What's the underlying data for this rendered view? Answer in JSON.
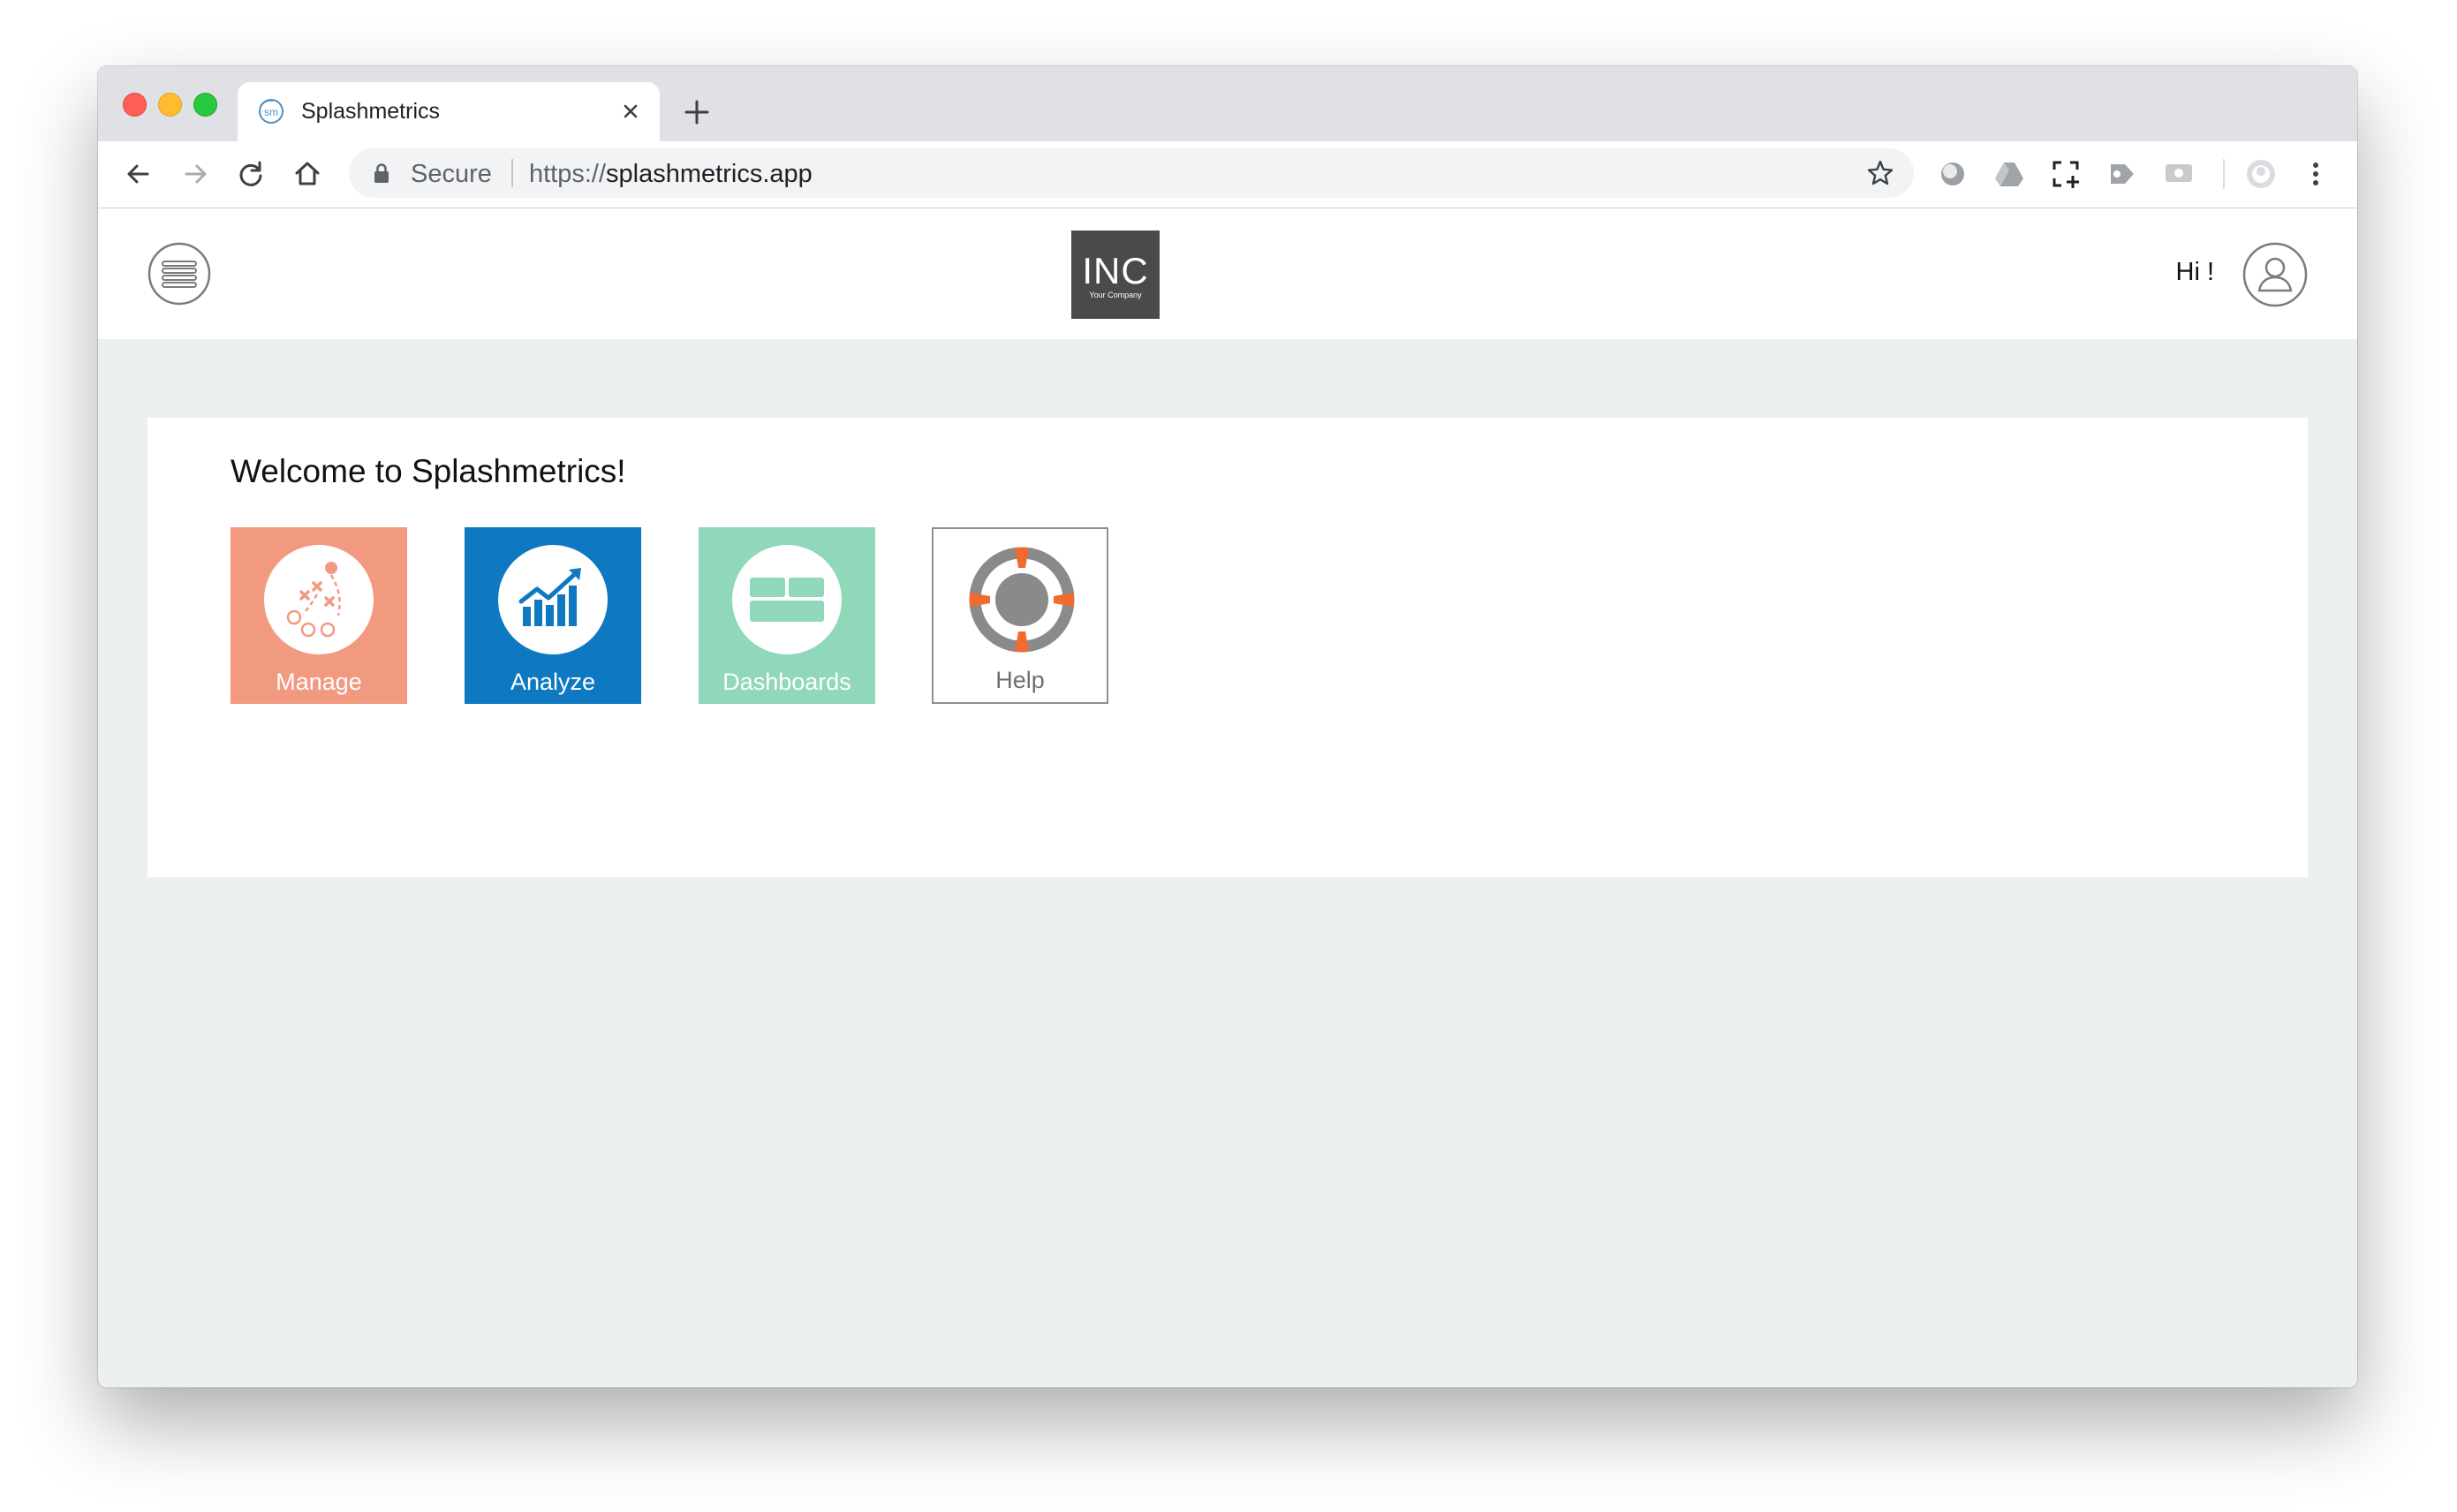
{
  "browser": {
    "tab": {
      "title": "Splashmetrics",
      "favicon_text": "sm"
    },
    "address_bar": {
      "security_label": "Secure",
      "url_scheme": "https://",
      "url_host": "splashmetrics.app"
    }
  },
  "app": {
    "logo": {
      "main": "INC",
      "sub": "Your Company"
    },
    "greeting": "Hi !",
    "welcome": "Welcome to Splashmetrics!",
    "tiles": [
      {
        "label": "Manage",
        "color": "#f29a80",
        "icon": "strategy-play-icon"
      },
      {
        "label": "Analyze",
        "color": "#0e78c1",
        "icon": "rising-bar-chart-icon"
      },
      {
        "label": "Dashboards",
        "color": "#91d7ba",
        "icon": "dashboard-panels-icon"
      },
      {
        "label": "Help",
        "color": "#ffffff",
        "icon": "lifebuoy-icon"
      }
    ]
  },
  "colors": {
    "page_background": "#ecf0f1",
    "lifebuoy_accent": "#f26b2e",
    "logo_background": "#4a4a4a"
  }
}
